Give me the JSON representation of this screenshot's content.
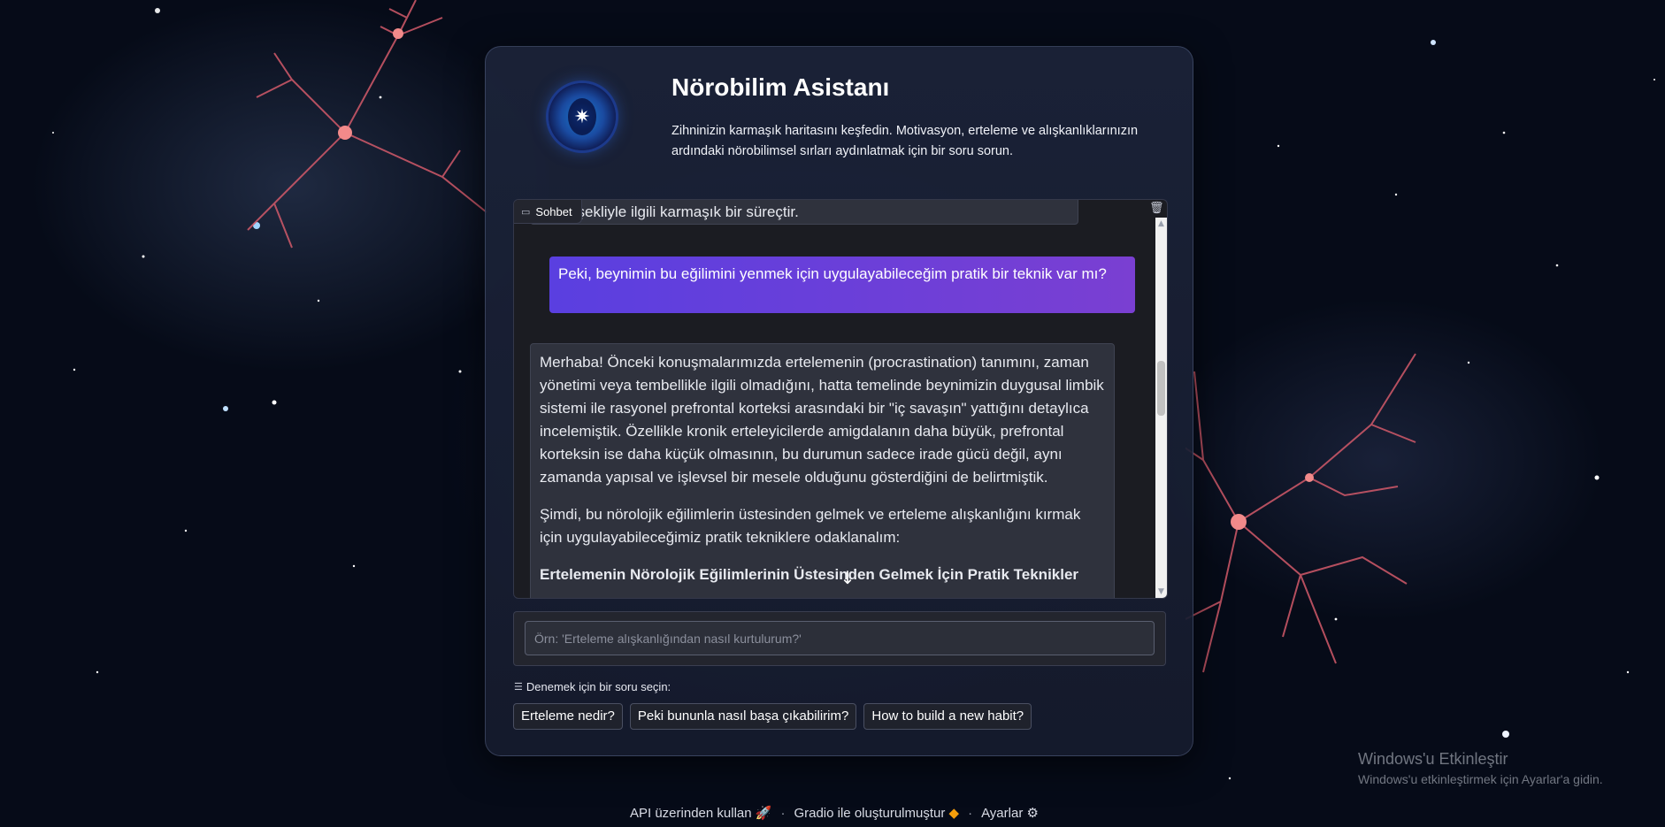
{
  "app": {
    "title": "Nörobilim Asistanı",
    "subtitle": "Zihninizin karmaşık haritasını keşfedin. Motivasyon, erteleme ve alışkanlıklarınızın ardındaki nörobilimsel sırları aydınlatmak için bir soru sorun.",
    "logo_icon": "brain-star-icon"
  },
  "chat": {
    "label": "Sohbet",
    "messages": [
      {
        "role": "assistant",
        "partial": true,
        "text": "...ma şekliyle ilgili karmaşık bir süreçtir."
      },
      {
        "role": "user",
        "text": "Peki, beynimin bu eğilimini yenmek için uygulayabileceğim pratik bir teknik var mı?"
      },
      {
        "role": "assistant",
        "paragraphs": [
          "Merhaba! Önceki konuşmalarımızda ertelemenin (procrastination) tanımını, zaman yönetimi veya tembellikle ilgili olmadığını, hatta temelinde beynimizin duygusal limbik sistemi ile rasyonel prefrontal korteksi arasındaki bir \"iç savaşın\" yattığını detaylıca incelemiştik. Özellikle kronik erteleyicilerde amigdalanın daha büyük, prefrontal korteksin ise daha küçük olmasının, bu durumun sadece irade gücü değil, aynı zamanda yapısal ve işlevsel bir mesele olduğunu gösterdiğini de belirtmiştik.",
          "Şimdi, bu nörolojik eğilimlerin üstesinden gelmek ve erteleme alışkanlığını kırmak için uygulayabileceğimiz pratik tekniklere odaklanalım:",
          "Ertelemenin Nörolojik Eğilimlerinin Üstesinden Gelmek İçin Pratik Teknikler"
        ]
      }
    ]
  },
  "input": {
    "placeholder": "Örn: 'Erteleme alışkanlığından nasıl kurtulurum?'",
    "value": ""
  },
  "examples": {
    "label": "Denemek için bir soru seçin:",
    "items": [
      "Erteleme nedir?",
      "Peki bununla nasıl başa çıkabilirim?",
      "How to build a new habit?"
    ]
  },
  "footer": {
    "api": "API üzerinden kullan",
    "gradio": "Gradio ile oluşturulmuştur",
    "settings": "Ayarlar",
    "separator": "·"
  },
  "windows": {
    "heading": "Windows'u Etkinleştir",
    "sub": "Windows'u etkinleştirmek için Ayarlar'a gidin."
  }
}
